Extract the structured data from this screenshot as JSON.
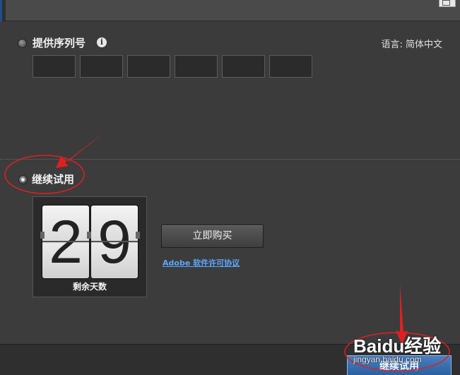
{
  "serial_section": {
    "label": "提供序列号",
    "info_icon": "i",
    "language": "语言: 简体中文",
    "boxes": 6
  },
  "trial_section": {
    "label": "继续试用",
    "days_left": "29",
    "days_digits": [
      "2",
      "9"
    ],
    "days_label": "剩余天数",
    "buy_button": "立即购买",
    "license_link": "Adobe 软件许可协议"
  },
  "footer": {
    "continue_button": "继续试用"
  },
  "watermark": {
    "brand": "Baidu经验",
    "url": "jingyan.baidu.com"
  },
  "colors": {
    "accent_annotation": "#e02020",
    "link": "#5ba6ff",
    "primary_button": "#2a5f9f"
  }
}
